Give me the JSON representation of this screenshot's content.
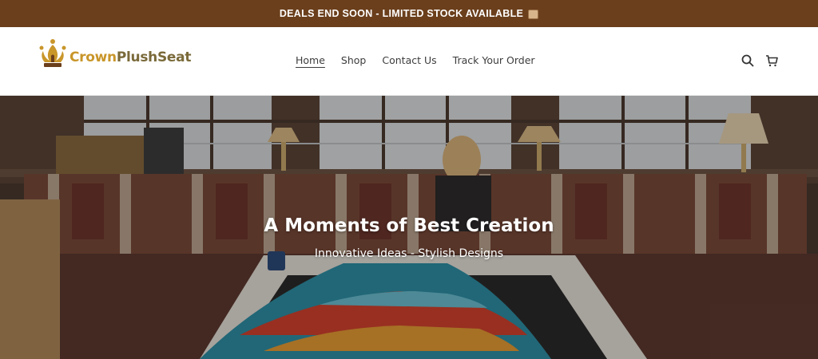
{
  "announcement": {
    "text": "DEALS END SOON - LIMITED STOCK AVAILABLE",
    "emoji_icon": "package-icon"
  },
  "brand": {
    "name_part1": "Crown",
    "name_part2": "PlushSeat",
    "logo_icon": "crown-icon",
    "accent_color": "#c9962a"
  },
  "nav": {
    "items": [
      {
        "label": "Home",
        "active": true
      },
      {
        "label": "Shop",
        "active": false
      },
      {
        "label": "Contact Us",
        "active": false
      },
      {
        "label": "Track Your Order",
        "active": false
      }
    ]
  },
  "header_icons": {
    "search": "search-icon",
    "cart": "cart-icon"
  },
  "hero": {
    "title": "A Moments of Best Creation",
    "subtitle": "Innovative Ideas - Stylish Designs"
  },
  "colors": {
    "announcement_bg": "#6b3f1c",
    "nav_text": "#3d3d3d"
  }
}
